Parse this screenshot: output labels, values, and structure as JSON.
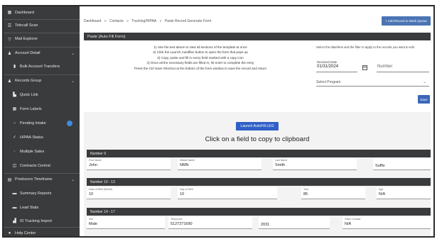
{
  "sidebar": {
    "items": [
      {
        "label": "Dashboard",
        "icon": "dashboard-icon",
        "glyph": "▦"
      },
      {
        "label": "Telecall Scan",
        "icon": "list-icon",
        "glyph": "☰"
      },
      {
        "label": "Mail Explorer",
        "icon": "filter-icon",
        "glyph": "▽"
      },
      {
        "label": "Account Detail",
        "icon": "accounts-icon",
        "glyph": "♟",
        "chevron": "⌄"
      },
      {
        "label": "Bulk Account Transfers",
        "icon": "transfer-icon",
        "glyph": "▮"
      },
      {
        "label": "Records Group",
        "icon": "group-icon",
        "glyph": "♟",
        "chevron": "⌄"
      },
      {
        "label": "Quick Link",
        "icon": "link-icon",
        "glyph": "▙"
      },
      {
        "label": "Form Labels",
        "icon": "form-icon",
        "glyph": "▦"
      },
      {
        "label": "Pending Intake",
        "icon": "pending-icon",
        "glyph": "−"
      },
      {
        "label": "HIPAA Status",
        "icon": "check-icon",
        "glyph": "✓"
      },
      {
        "label": "Multiple Sales",
        "icon": "multiple-icon",
        "glyph": "◦"
      },
      {
        "label": "Contracts Central",
        "icon": "contract-icon",
        "glyph": "◫"
      },
      {
        "label": "Producers Timeframe",
        "icon": "table-icon",
        "glyph": "▤",
        "chevron": "⌄"
      },
      {
        "label": "Summary Reports",
        "icon": "report-icon",
        "glyph": "▬"
      },
      {
        "label": "Lead Stats",
        "icon": "stats-icon",
        "glyph": "▬"
      },
      {
        "label": "ID Tracking Import",
        "icon": "import-icon",
        "glyph": "▟"
      },
      {
        "label": "Help Center",
        "icon": "help-icon",
        "glyph": "●"
      }
    ]
  },
  "breadcrumb": [
    "Dashboard",
    "»",
    "Contacts",
    "»",
    "Tracking/HIPAA",
    "»",
    "Paste Record Generate Form"
  ],
  "top_button": "+ Add Record to Work Queue",
  "card": {
    "title": "Paste (Auto Fill Form)",
    "instructions": [
      "1) Use the text above to view all sections of the template at once",
      "2) Click the Launch Autofiller button to open the form that pops up",
      "3) Copy, paste and fill in every field marked with a copy icon",
      "4) Once all the necessary fields are filled in, hit enter to complete the entry",
      "Press the Ctrl Save Shortcut at the bottom of the form window to save the record and return"
    ],
    "right_label": "Select the date/time and the filter to apply to the records you want to edit",
    "date_label": "Received Date",
    "date_value": "01/31/2024",
    "number_placeholder": "Number",
    "select_value": "Select Program",
    "small_btn": "Save"
  },
  "launch_button": "Launch AutoFill LEG",
  "click_message": "Click on a field to copy to clipboard",
  "groups": [
    {
      "title": "Number 9",
      "fields": [
        {
          "label": "First Name",
          "value": "John"
        },
        {
          "label": "Middle Name",
          "value": "NMN"
        },
        {
          "label": "Last Name",
          "value": "Smith"
        },
        {
          "label": "",
          "value": "Suffix"
        }
      ]
    },
    {
      "title": "Number 10 - 13",
      "fields": [
        {
          "label": "Date of Birth (Month)",
          "value": "10"
        },
        {
          "label": "Day of Birth",
          "value": "10"
        },
        {
          "label": "Year",
          "value": "85"
        },
        {
          "label": "Age",
          "value": "N/A"
        }
      ]
    },
    {
      "title": "Number 14 - 17",
      "fields": [
        {
          "label": "Sex",
          "value": "Male"
        },
        {
          "label": "Telephone",
          "value": "5127271690"
        },
        {
          "label": "",
          "value": "2031"
        },
        {
          "label": "Other Contact",
          "value": "N/A"
        }
      ]
    }
  ]
}
